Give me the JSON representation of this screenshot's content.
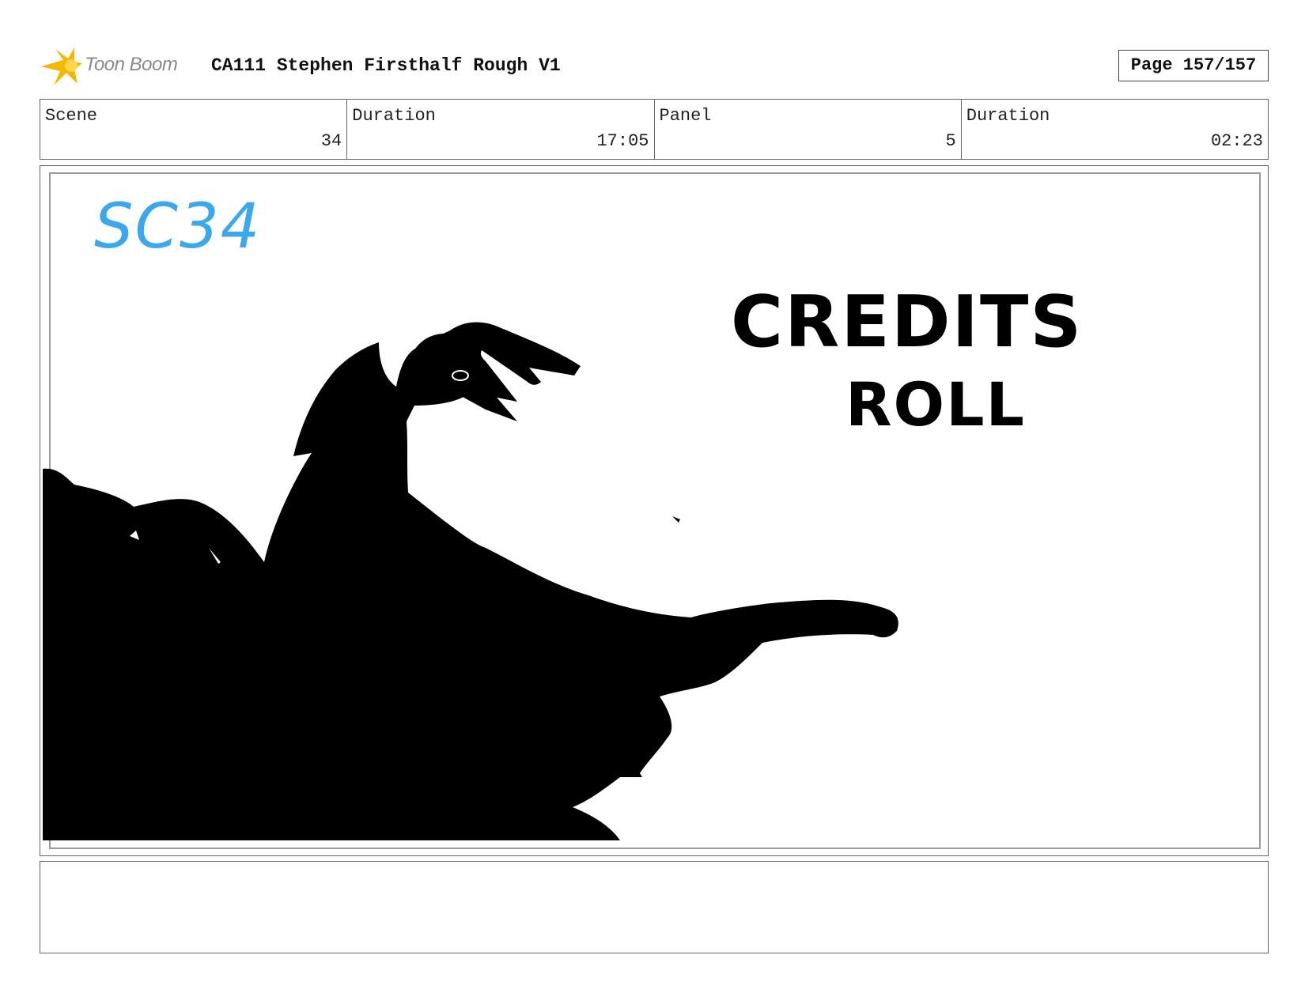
{
  "header": {
    "logo_text": "Toon Boom",
    "title": "CA111 Stephen Firsthalf Rough V1",
    "page_label": "Page 157/157"
  },
  "info": [
    {
      "label": "Scene",
      "value": "34"
    },
    {
      "label": "Duration",
      "value": "17:05"
    },
    {
      "label": "Panel",
      "value": "5"
    },
    {
      "label": "Duration",
      "value": "02:23"
    }
  ],
  "panel": {
    "scene_note": "SC34",
    "credits_line1": "CREDITS",
    "credits_line2": "ROLL",
    "ink_color": "#000000",
    "note_color": "#3aa8ea"
  },
  "notes": {
    "text": ""
  },
  "colors": {
    "logo_star": "#f5b800",
    "border": "#666666"
  }
}
